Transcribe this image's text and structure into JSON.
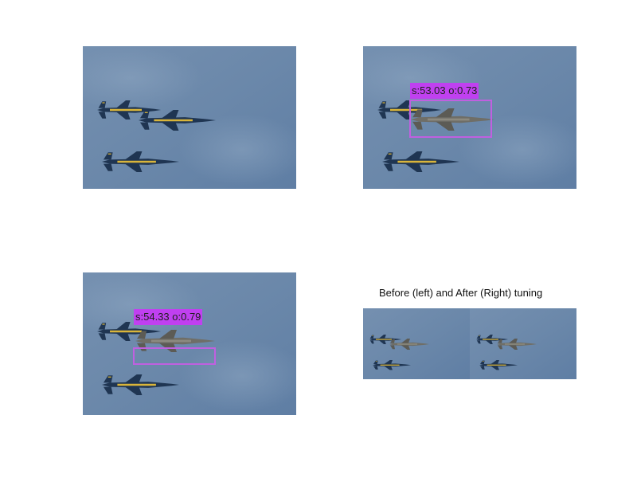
{
  "panels": {
    "top_right": {
      "label": "s:53.03 o:0.73"
    },
    "bottom_left": {
      "label": "s:54.33 o:0.79"
    },
    "bottom_right": {
      "caption": "Before (left) and After (Right) tuning"
    }
  },
  "colors": {
    "sky": "#6f8daf",
    "jet_body": "#1f3552",
    "jet_stripe": "#d9b53a",
    "jet_tuned": "#7b7a72",
    "box": "#c060e0",
    "label_bg": "#c040f0"
  }
}
